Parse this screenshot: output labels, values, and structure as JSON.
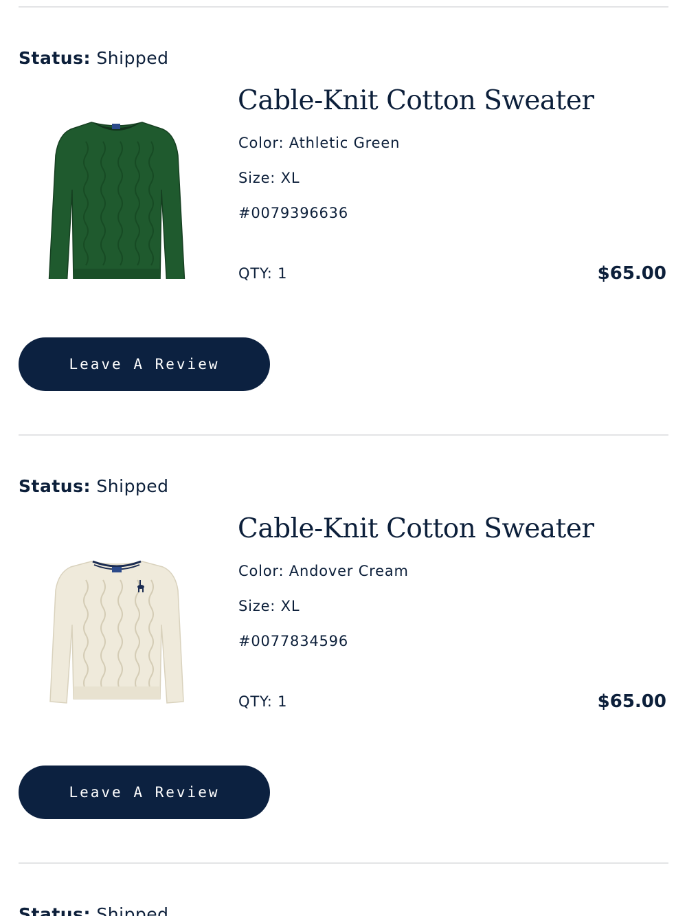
{
  "orders": [
    {
      "status_label": "Status:",
      "status_value": "Shipped",
      "product": {
        "title": "Cable-Knit Cotton Sweater",
        "color": "Color: Athletic Green",
        "size": "Size: XL",
        "sku": "#0079396636",
        "qty": "QTY: 1",
        "price": "$65.00",
        "image_color": "#1f5a2e",
        "image": "green-sweater-image"
      },
      "review_label": "Leave A Review"
    },
    {
      "status_label": "Status:",
      "status_value": "Shipped",
      "product": {
        "title": "Cable-Knit Cotton Sweater",
        "color": "Color: Andover Cream",
        "size": "Size: XL",
        "sku": "#0077834596",
        "qty": "QTY: 1",
        "price": "$65.00",
        "image_color": "#efeadb",
        "image": "cream-sweater-image"
      },
      "review_label": "Leave A Review"
    },
    {
      "status_label": "Status:",
      "status_value": "Shipped"
    }
  ],
  "colors": {
    "navy": "#0c2140",
    "divider": "#e3e4e6"
  }
}
